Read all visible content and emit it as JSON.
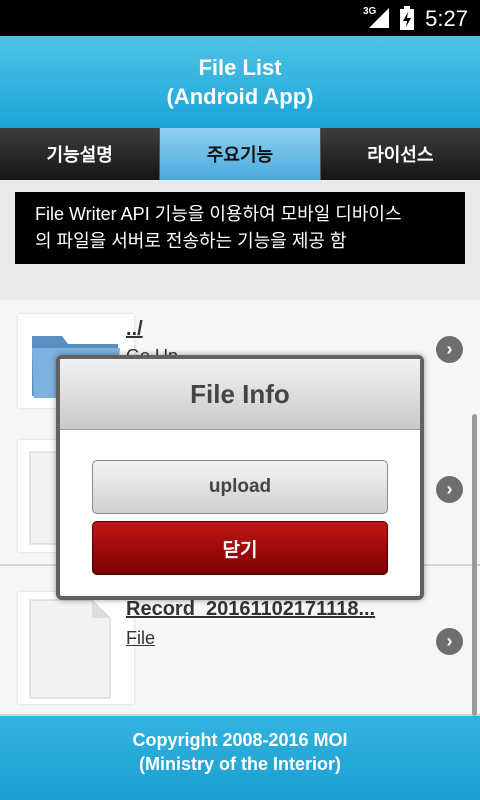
{
  "status_bar": {
    "network": "3G",
    "time": "5:27"
  },
  "header": {
    "title_line1": "File List",
    "title_line2": "(Android App)"
  },
  "tabs": [
    {
      "label": "기능설명",
      "active": false
    },
    {
      "label": "주요기능",
      "active": true
    },
    {
      "label": "라이선스",
      "active": false
    }
  ],
  "description": {
    "line1": "File Writer API 기능을 이용하여 모바일 디바이스",
    "line2": "의 파일을 서버로 전송하는 기능을 제공 함"
  },
  "file_list": [
    {
      "name": "../",
      "subtitle": "Go Up",
      "icon": "folder-icon"
    },
    {
      "name": "",
      "subtitle": "",
      "icon": "file-icon"
    },
    {
      "name": "Record_20161102171118...",
      "subtitle": "File",
      "icon": "file-icon"
    }
  ],
  "dialog": {
    "title": "File Info",
    "upload_label": "upload",
    "close_label": "닫기"
  },
  "footer": {
    "line1": "Copyright 2008-2016 MOI",
    "line2": "(Ministry of the Interior)"
  },
  "colors": {
    "header": "#1aa5d6",
    "active_tab": "#4aa8dc",
    "close_button": "#a00000"
  }
}
